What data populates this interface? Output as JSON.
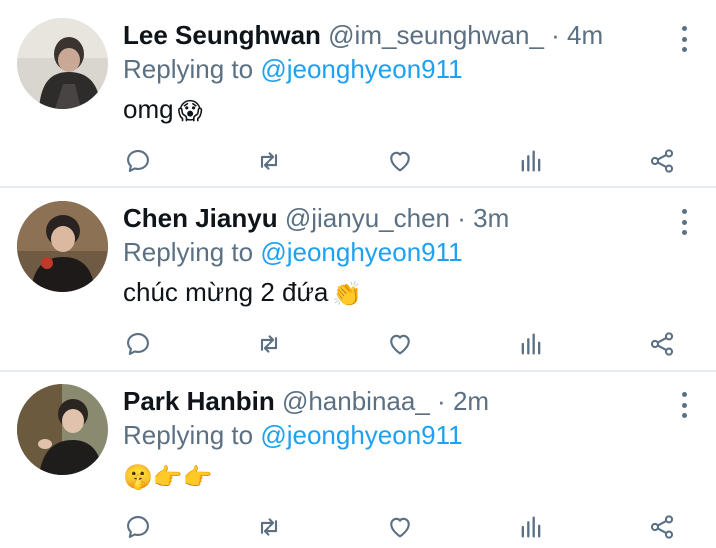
{
  "tweets": [
    {
      "name": "Lee Seunghwan",
      "handle": "@im_seunghwan_",
      "separator": "·",
      "time": "4m",
      "replying_label": "Replying to",
      "mention": "@jeonghyeon911",
      "text": "omg",
      "emoji": "😱",
      "avatar_icon": "avatar-photo"
    },
    {
      "name": "Chen Jianyu",
      "handle": "@jianyu_chen",
      "separator": "·",
      "time": "3m",
      "replying_label": "Replying to",
      "mention": "@jeonghyeon911",
      "text": "chúc mừng 2 đứa",
      "emoji": "👏",
      "avatar_icon": "avatar-photo"
    },
    {
      "name": "Park Hanbin",
      "handle": "@hanbinaa_",
      "separator": "·",
      "time": "2m",
      "replying_label": "Replying to",
      "mention": "@jeonghyeon911",
      "text": "",
      "emoji": "🤫👉👉",
      "avatar_icon": "avatar-photo"
    }
  ],
  "action_icons": [
    "reply-icon",
    "retweet-icon",
    "like-icon",
    "analytics-icon",
    "share-icon"
  ],
  "colors": {
    "accent": "#1da1f2",
    "secondary_text": "#5b7083",
    "primary_text": "#0f1419",
    "divider": "#e6ecf0"
  }
}
